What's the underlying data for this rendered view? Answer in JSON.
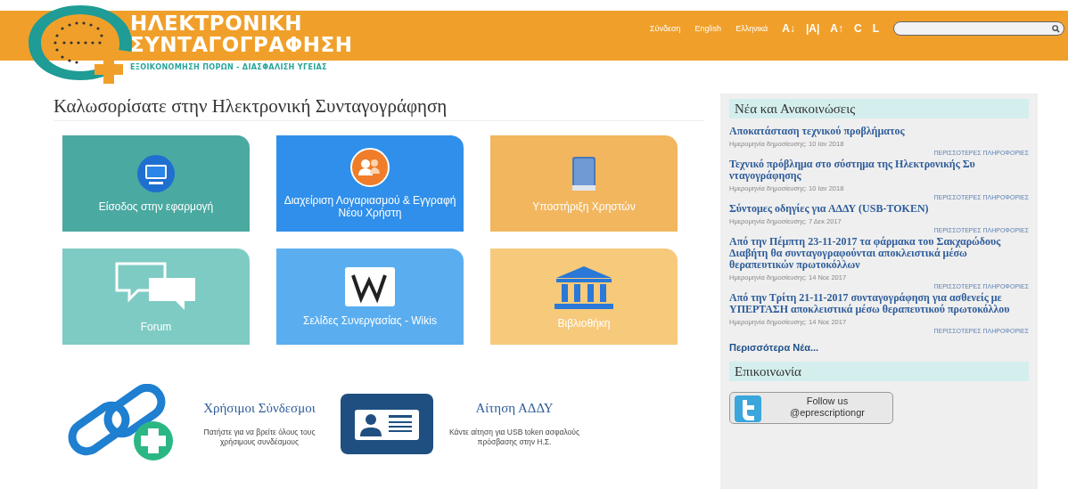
{
  "header": {
    "logo": {
      "line1": "ΗΛΕΚΤΡΟΝΙΚΗ",
      "line2": "ΣΥΝΤΑΓΟΓΡΑΦΗΣΗ",
      "tagline": "ΕΞΟΙΚΟΝΟΜΗΣΗ ΠΟΡΩΝ - ΔΙΑΣΦΑΛΙΣΗ ΥΓΕΙΑΣ"
    },
    "nav": [
      {
        "label": "Σύνδεση",
        "kind": "link"
      },
      {
        "label": "English",
        "kind": "link"
      },
      {
        "label": "Ελληνικά",
        "kind": "link"
      }
    ],
    "tools": [
      "A↓",
      "|A|",
      "A↑",
      "C",
      "L"
    ],
    "search": {
      "kind": "search"
    }
  },
  "title": "Καλωσορίσατε στην Ηλεκτρονική Συνταγογράφηση",
  "tiles": [
    {
      "label": "Είσοδος στην εφαρμογή",
      "kind": "monitor",
      "color": "#4aa9a1"
    },
    {
      "label": "Διαχείριση Λογαριασμού & Εγγραφή Νέου Χρήστη",
      "kind": "users",
      "color": "#2f8fea"
    },
    {
      "label": "Υποστήριξη Χρηστών",
      "kind": "book",
      "color": "#f2b65e"
    },
    {
      "label": "Forum",
      "kind": "chat",
      "color": "#7ecbc4"
    },
    {
      "label": "Σελίδες Συνεργασίας - Wikis",
      "kind": "wiki",
      "color": "#5aaef0"
    },
    {
      "label": "Βιβλιοθήκη",
      "kind": "library",
      "color": "#f6c97b"
    }
  ],
  "promos": [
    {
      "kind": "links",
      "title": "Χρήσιμοι Σύνδεσμοι",
      "text": "Πατήστε για να βρείτε όλους τους χρήσιμους συνδέσμους"
    },
    {
      "kind": "card",
      "title": "Αίτηση ΑΔΔΥ",
      "text": "Κάντε αίτηση για USB token ασφαλούς πρόσβασης στην Η.Σ."
    }
  ],
  "news": {
    "heading": "Νέα και Ανακοινώσεις",
    "items": [
      {
        "title": "Αποκατάσταση τεχνικού προβλήματος",
        "date": "Ημερομηνία δημοσίευσης: 10 Ιαν 2018",
        "more": "ΠΕΡΙΣΣΟΤΕΡΕΣ ΠΛΗΡΟΦΟΡΙΕΣ"
      },
      {
        "title": "Τεχνικό πρόβλημα στο σύστημα της Ηλεκτρονικής Συ νταγογράφησης",
        "date": "Ημερομηνία δημοσίευσης: 10 Ιαν 2018",
        "more": "ΠΕΡΙΣΣΟΤΕΡΕΣ ΠΛΗΡΟΦΟΡΙΕΣ"
      },
      {
        "title": "Σύντομες οδηγίες για ΑΔΔΥ (USB-TOKEN)",
        "date": "Ημερομηνία δημοσίευσης: 7 Δεκ 2017",
        "more": "ΠΕΡΙΣΣΟΤΕΡΕΣ ΠΛΗΡΟΦΟΡΙΕΣ"
      },
      {
        "title": "Από την Πέμπτη 23-11-2017 τα φάρμακα του Σακχαρώδους Διαβήτη θα συνταγογραφούνται αποκλειστικά μέσω θεραπευτικών πρωτοκόλλων",
        "date": "Ημερομηνία δημοσίευσης: 14 Νοε 2017",
        "more": "ΠΕΡΙΣΣΟΤΕΡΕΣ ΠΛΗΡΟΦΟΡΙΕΣ"
      },
      {
        "title": "Από την Τρίτη 21-11-2017 συνταγογράφηση για ασθενείς με ΥΠΕΡΤΑΣΗ αποκλειστικά μέσω θεραπευτικού πρωτοκόλλου",
        "date": "Ημερομηνία δημοσίευσης: 14 Νοε 2017",
        "more": "ΠΕΡΙΣΣΟΤΕΡΕΣ ΠΛΗΡΟΦΟΡΙΕΣ"
      }
    ],
    "all": "Περισσότερα Νέα..."
  },
  "contact": {
    "heading": "Επικοινωνία",
    "follow_line1": "Follow us",
    "follow_line2": "@eprescriptiongr"
  }
}
